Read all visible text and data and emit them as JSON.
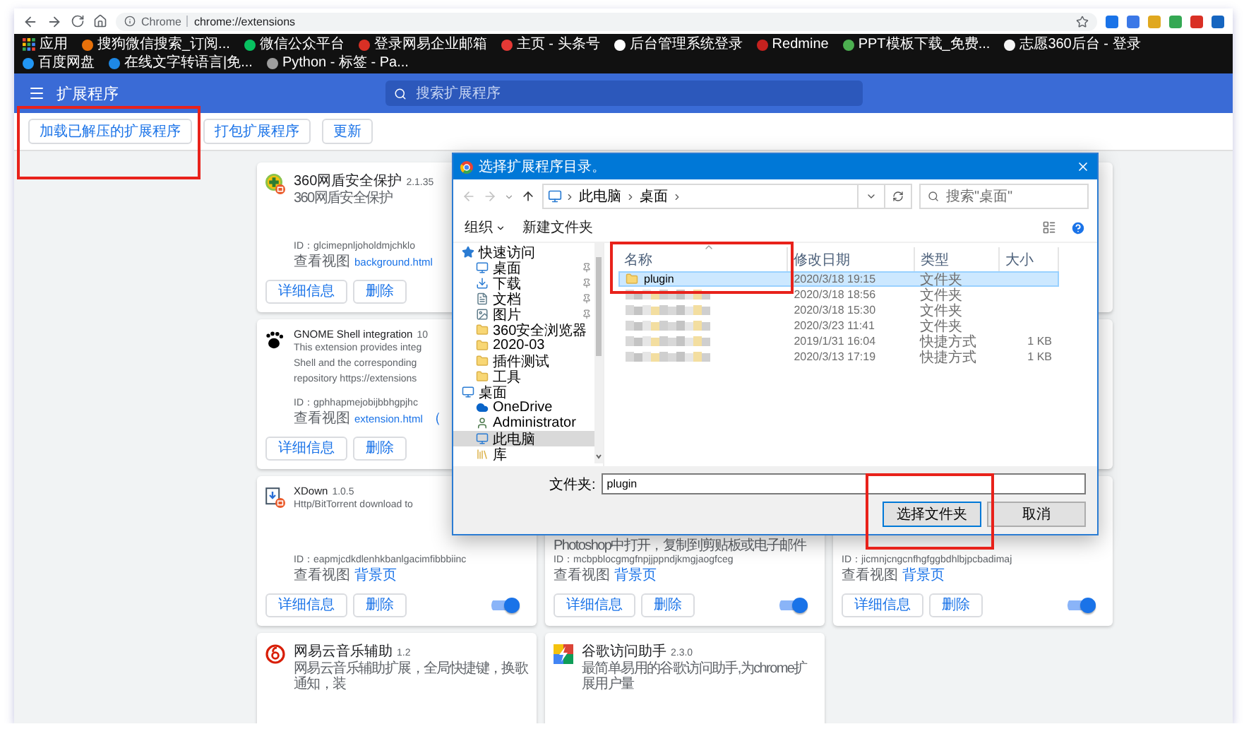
{
  "browser": {
    "omnibox": {
      "label": "Chrome",
      "url": "chrome://extensions"
    },
    "bookmarks": [
      {
        "title": "应用",
        "kind": "apps"
      },
      {
        "title": "搜狗微信搜索_订阅...",
        "kind": "site",
        "color": "#e8710a"
      },
      {
        "title": "微信公众平台",
        "kind": "site",
        "color": "#07c160"
      },
      {
        "title": "登录网易企业邮箱",
        "kind": "site",
        "color": "#d93025"
      },
      {
        "title": "主页 - 头条号",
        "kind": "site",
        "color": "#e53935"
      },
      {
        "title": "后台管理系统登录",
        "kind": "site",
        "color": "#ffffff"
      },
      {
        "title": "Redmine",
        "kind": "site",
        "color": "#c5221f"
      },
      {
        "title": "PPT模板下载_免费...",
        "kind": "site",
        "color": "#4caf50"
      },
      {
        "title": "志愿360后台 - 登录",
        "kind": "site",
        "color": "#f5f5f5"
      },
      {
        "title": "百度网盘",
        "kind": "site",
        "color": "#2196f3"
      },
      {
        "title": "在线文字转语言|免...",
        "kind": "site",
        "color": "#1e88e5"
      },
      {
        "title": "Python - 标签 - Pa...",
        "kind": "site",
        "color": "#9e9e9e"
      }
    ]
  },
  "header": {
    "title": "扩展程序",
    "search_placeholder": "搜索扩展程序"
  },
  "actions": [
    {
      "label": "加载已解压的扩展程序",
      "highlighted": true
    },
    {
      "label": "打包扩展程序",
      "highlighted": false
    },
    {
      "label": "更新",
      "highlighted": false
    }
  ],
  "cards": [
    {
      "kind": "extension",
      "name": "360网盾安全保护",
      "version": "2.1.35",
      "description": [
        "360网盾安全保护"
      ],
      "id": "ID：glcimepnljoholdmjchklo",
      "view_label": "查看视图",
      "view_link": "background.html",
      "buttons": [
        "详细信息",
        "删除"
      ]
    },
    {
      "kind": "covered"
    },
    {
      "kind": "blank"
    },
    {
      "kind": "extension",
      "name": "GNOME Shell integration",
      "version": "10",
      "description": [
        "This extension provides integ",
        "Shell and the corresponding",
        "repository https://extensions"
      ],
      "id": "ID：gphhapmejobijbbhgpjhc",
      "view_label": "查看视图",
      "view_link": "extension.html",
      "view_note": "（",
      "buttons": [
        "详细信息",
        "删除"
      ]
    },
    {
      "kind": "covered"
    },
    {
      "kind": "blank"
    },
    {
      "kind": "extension",
      "name": "XDown",
      "version": "1.0.5",
      "description": [
        "Http/BitTorrent download to"
      ],
      "id": "ID：eapmjcdkdlenhkbanlgacimfibbbiinc",
      "view_label": "查看视图",
      "view_link": "背景页",
      "buttons": [
        "详细信息",
        "删除"
      ],
      "on": true
    },
    {
      "kind": "extension",
      "description": [
        "Photoshop中打开，复制到剪贴板或电子邮件"
      ],
      "id": "ID：mcbpblocgmgfnpjjppndjkmgjaogfceg",
      "view_label": "查看视图",
      "view_link": "背景页",
      "buttons": [
        "详细信息",
        "删除"
      ],
      "on": true
    },
    {
      "kind": "extension",
      "id": "ID：jicmnjcngcnfhgfggbdhlbjpcbadimaj",
      "view_label": "查看视图",
      "view_link": "背景页",
      "buttons": [
        "详细信息",
        "删除"
      ],
      "on": true
    },
    {
      "kind": "extension",
      "name": "网易云音乐辅助",
      "version": "1.2",
      "description": [
        "网易云音乐辅助扩展，全局快捷键，换歌通知，装"
      ]
    },
    {
      "kind": "extension",
      "name": "谷歌访问助手",
      "version": "2.3.0",
      "description": [
        "最简单易用的谷歌访问助手,为chrome扩展用户量"
      ]
    }
  ],
  "dialog": {
    "title": "选择扩展程序目录。",
    "path": [
      "此电脑",
      "桌面"
    ],
    "search_placeholder": "搜索\"桌面\"",
    "organize": "组织",
    "new_folder": "新建文件夹",
    "sidebar": [
      {
        "label": "快速访问",
        "kind": "star",
        "selected": false,
        "children": [
          {
            "label": "桌面",
            "kind": "desktop",
            "pinned": true,
            "selected": false
          },
          {
            "label": "下载",
            "kind": "download",
            "pinned": true,
            "selected": false
          },
          {
            "label": "文档",
            "kind": "document",
            "pinned": true,
            "selected": false
          },
          {
            "label": "图片",
            "kind": "picture",
            "pinned": true,
            "selected": false
          },
          {
            "label": "360安全浏览器",
            "kind": "folder",
            "pinned": false,
            "selected": false
          },
          {
            "label": "2020-03",
            "kind": "folder",
            "pinned": false,
            "selected": false
          },
          {
            "label": "插件测试",
            "kind": "folder",
            "pinned": false,
            "selected": false
          },
          {
            "label": "工具",
            "kind": "folder",
            "pinned": false,
            "selected": false
          }
        ]
      },
      {
        "label": "桌面",
        "kind": "desktop",
        "selected": false,
        "children": [
          {
            "label": "OneDrive",
            "kind": "cloud",
            "selected": false
          },
          {
            "label": "Administrator",
            "kind": "user",
            "selected": false
          },
          {
            "label": "此电脑",
            "kind": "pc",
            "selected": true
          },
          {
            "label": "库",
            "kind": "library",
            "selected": false
          }
        ]
      }
    ],
    "columns": [
      {
        "label": "名称",
        "sorted": true,
        "highlighted": true
      },
      {
        "label": "修改日期",
        "sorted": false,
        "highlighted": false
      },
      {
        "label": "类型",
        "sorted": false,
        "highlighted": false
      },
      {
        "label": "大小",
        "sorted": false,
        "highlighted": false
      }
    ],
    "rows": [
      {
        "name": "plugin",
        "date": "2020/3/18 19:15",
        "type": "文件夹",
        "selected": true,
        "redacted": false
      },
      {
        "date": "2020/3/18 18:56",
        "type": "文件夹",
        "selected": false,
        "redacted": true
      },
      {
        "date": "2020/3/18 15:30",
        "type": "文件夹",
        "selected": false,
        "redacted": true
      },
      {
        "date": "2020/3/23 11:41",
        "type": "文件夹",
        "selected": false,
        "redacted": true
      },
      {
        "date": "2019/1/31 16:04",
        "type": "快捷方式",
        "size": "1 KB",
        "selected": false,
        "redacted": true
      },
      {
        "date": "2020/3/13 17:19",
        "type": "快捷方式",
        "size": "1 KB",
        "selected": false,
        "redacted": true
      }
    ],
    "footer": {
      "label": "文件夹:",
      "value": "plugin",
      "buttons": [
        {
          "label": "选择文件夹",
          "default": true,
          "highlighted": true
        },
        {
          "label": "取消",
          "default": false,
          "highlighted": false
        }
      ]
    }
  }
}
